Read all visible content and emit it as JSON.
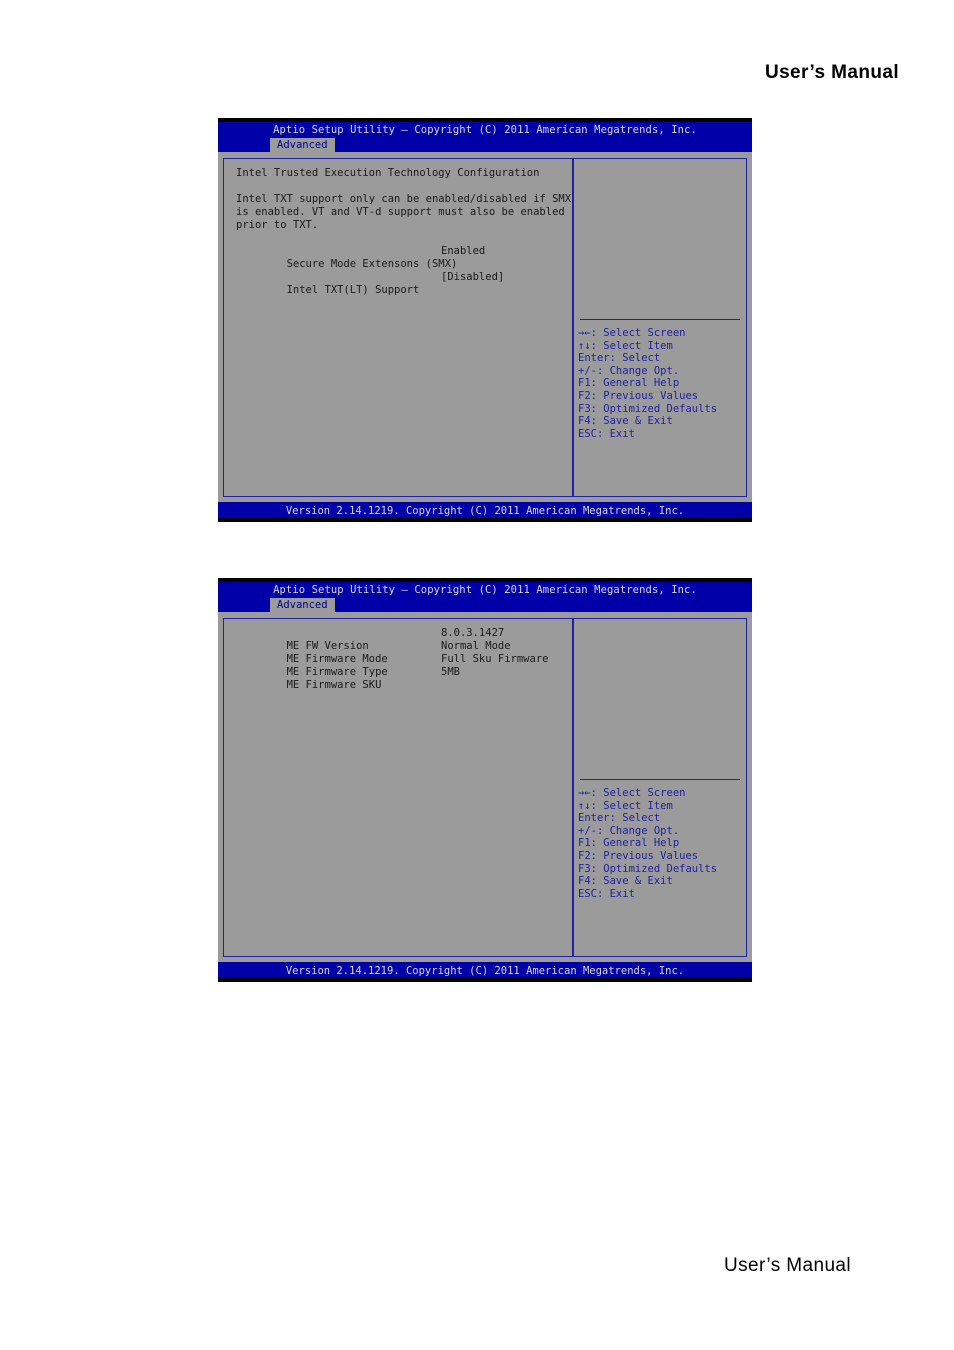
{
  "page": {
    "header_title": "User’s  Manual",
    "footer_title": "User’s  Manual"
  },
  "colors": {
    "bios_blue": "#0000a8",
    "bios_gray": "#9b9b9b",
    "border_blue": "#2020a0",
    "help_text": "#2020a0",
    "title_text": "#d8d8d8",
    "body_text": "#1a1a1a"
  },
  "bios_screens": [
    {
      "id": "txt-configuration",
      "title": "Aptio Setup Utility – Copyright (C) 2011 American Megatrends, Inc.",
      "tab": "Advanced",
      "section_title": "Intel Trusted Execution Technology Configuration",
      "description": [
        "Intel TXT support only can be enabled/disabled if SMX",
        "is enabled. VT and VT-d support must also be enabled",
        "prior to TXT."
      ],
      "items": [
        {
          "label": "Secure Mode Extensons (SMX)",
          "value": "Enabled"
        },
        {
          "label": "Intel TXT(LT) Support",
          "value": "[Disabled]"
        }
      ],
      "help_keys": [
        "→←: Select Screen",
        "↑↓: Select Item",
        "Enter: Select",
        "+/-: Change Opt.",
        "F1: General Help",
        "F2: Previous Values",
        "F3: Optimized Defaults",
        "F4: Save & Exit",
        "ESC: Exit"
      ],
      "footer": "Version 2.14.1219. Copyright (C) 2011 American Megatrends, Inc."
    },
    {
      "id": "me-firmware-info",
      "title": "Aptio Setup Utility – Copyright (C) 2011 American Megatrends, Inc.",
      "tab": "Advanced",
      "section_title": "",
      "description": [],
      "items": [
        {
          "label": "ME FW Version",
          "value": "8.0.3.1427"
        },
        {
          "label": "ME Firmware Mode",
          "value": "Normal Mode"
        },
        {
          "label": "ME Firmware Type",
          "value": "Full Sku Firmware"
        },
        {
          "label": "ME Firmware SKU",
          "value": "5MB"
        }
      ],
      "help_keys": [
        "→←: Select Screen",
        "↑↓: Select Item",
        "Enter: Select",
        "+/-: Change Opt.",
        "F1: General Help",
        "F2: Previous Values",
        "F3: Optimized Defaults",
        "F4: Save & Exit",
        "ESC: Exit"
      ],
      "footer": "Version 2.14.1219. Copyright (C) 2011 American Megatrends, Inc."
    }
  ]
}
